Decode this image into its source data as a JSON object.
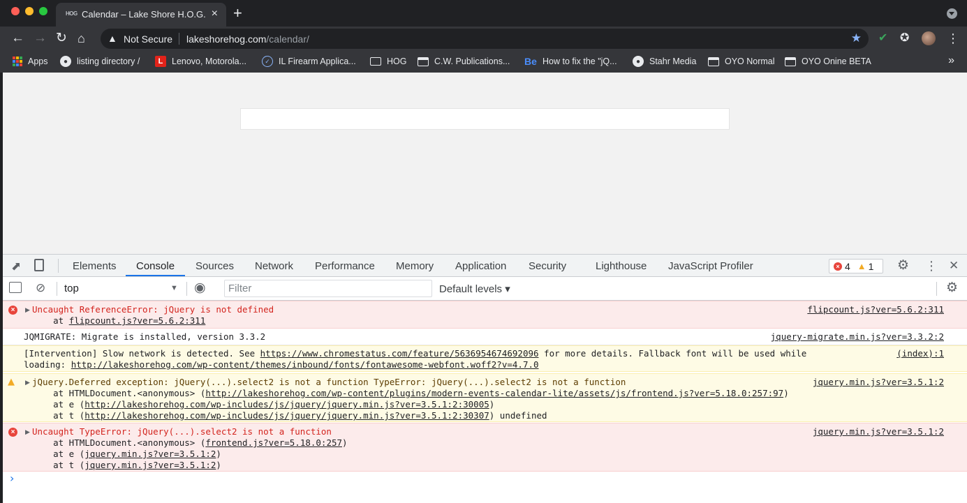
{
  "browser": {
    "tab": {
      "favicon": "HOG",
      "title": "Calendar – Lake Shore H.O.G.",
      "close": "×"
    },
    "new_tab": "+",
    "omnibox": {
      "security_label": "Not Secure",
      "url_host": "lakeshorehog.com",
      "url_path": "/calendar/"
    },
    "bookmarks": [
      {
        "label": "Apps",
        "icon": "apps-grid-icon"
      },
      {
        "label": "listing directory /",
        "icon": "globe-icon"
      },
      {
        "label": "Lenovo, Motorola...",
        "icon": "lenovo-logo-icon"
      },
      {
        "label": "IL Firearm Applica...",
        "icon": "check-circle-icon"
      },
      {
        "label": "HOG",
        "icon": "folder-icon"
      },
      {
        "label": "C.W. Publications...",
        "icon": "window-icon"
      },
      {
        "label": "How to fix the \"jQ...",
        "icon": "behance-icon"
      },
      {
        "label": "Stahr Media",
        "icon": "globe-icon"
      },
      {
        "label": "OYO Normal",
        "icon": "window-icon"
      },
      {
        "label": "OYO Onine BETA",
        "icon": "window-icon"
      }
    ],
    "bookmarks_more": "»"
  },
  "devtools": {
    "tabs": [
      "Elements",
      "Console",
      "Sources",
      "Network",
      "Performance",
      "Memory",
      "Application",
      "Security",
      "Lighthouse",
      "JavaScript Profiler"
    ],
    "active_tab": "Console",
    "error_count": "4",
    "warning_count": "1",
    "context": "top",
    "filter_placeholder": "Filter",
    "levels_label": "Default levels ▾",
    "colors": {
      "accent": "#1a73e8",
      "error": "#d3241e",
      "error_bg": "#fcebeb",
      "warning_bg": "#fefbe5"
    }
  },
  "console": {
    "messages": [
      {
        "level": "error",
        "source": "flipcount.js?ver=5.6.2:311",
        "line1": "Uncaught ReferenceError: jQuery is not defined",
        "line2_prefix": "    at ",
        "line2_link": "flipcount.js?ver=5.6.2:311"
      },
      {
        "level": "log",
        "source": "jquery-migrate.min.js?ver=3.3.2:2",
        "line1": "JQMIGRATE: Migrate is installed, version 3.3.2"
      },
      {
        "level": "violation",
        "source": "(index):1",
        "line1_prefix": "[Intervention] Slow network is detected. See ",
        "line1_link": "https://www.chromestatus.com/feature/5636954674692096",
        "line1_suffix": " for more details. Fallback font will be used while",
        "line2_prefix": "loading: ",
        "line2_link": "http://lakeshorehog.com/wp-content/themes/inbound/fonts/fontawesome-webfont.woff2?v=4.7.0"
      },
      {
        "level": "warning",
        "source": "jquery.min.js?ver=3.5.1:2",
        "line1": "jQuery.Deferred exception: jQuery(...).select2 is not a function TypeError: jQuery(...).select2 is not a function",
        "line2_prefix": "    at HTMLDocument.<anonymous> (",
        "line2_link": "http://lakeshorehog.com/wp-content/plugins/modern-events-calendar-lite/assets/js/frontend.js?ver=5.18.0:257:97",
        "line2_suffix": ")",
        "line3_prefix": "    at e (",
        "line3_link": "http://lakeshorehog.com/wp-includes/js/jquery/jquery.min.js?ver=3.5.1:2:30005",
        "line3_suffix": ")",
        "line4_prefix": "    at t (",
        "line4_link": "http://lakeshorehog.com/wp-includes/js/jquery/jquery.min.js?ver=3.5.1:2:30307",
        "line4_suffix": ") undefined"
      },
      {
        "level": "error",
        "source": "jquery.min.js?ver=3.5.1:2",
        "line1": "Uncaught TypeError: jQuery(...).select2 is not a function",
        "line2_prefix": "    at HTMLDocument.<anonymous> (",
        "line2_link": "frontend.js?ver=5.18.0:257",
        "line2_suffix": ")",
        "line3_prefix": "    at e (",
        "line3_link": "jquery.min.js?ver=3.5.1:2",
        "line3_suffix": ")",
        "line4_prefix": "    at t (",
        "line4_link": "jquery.min.js?ver=3.5.1:2",
        "line4_suffix": ")"
      }
    ],
    "prompt": "›"
  }
}
